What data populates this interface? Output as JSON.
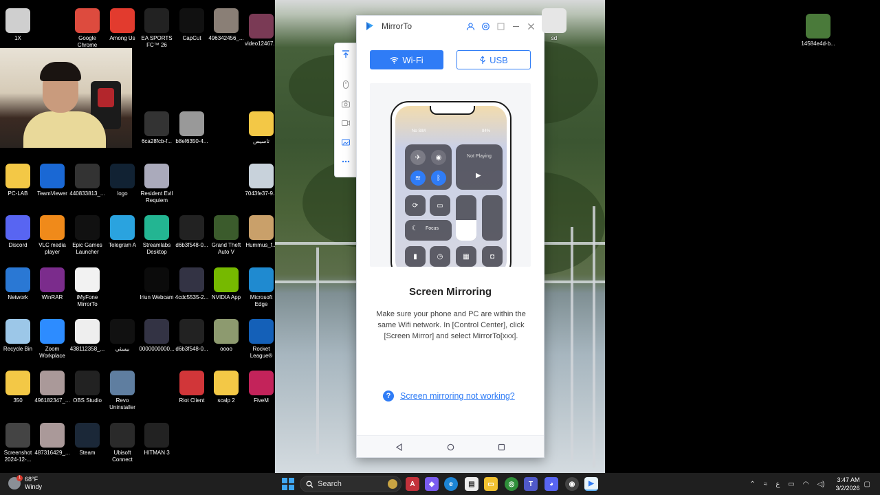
{
  "desktop_icons": [
    {
      "label": "1X"
    },
    {
      "label": "Google Chrome"
    },
    {
      "label": "Among Us"
    },
    {
      "label": "EA SPORTS FC™ 26"
    },
    {
      "label": "CapCut"
    },
    {
      "label": "496342456_..."
    },
    {
      "label": "video12467..."
    },
    {
      "label": "6ca28fcb-f..."
    },
    {
      "label": "b8ef6350-4..."
    },
    {
      "label": "تاسيس"
    },
    {
      "label": "PC-LAB"
    },
    {
      "label": "TeamViewer"
    },
    {
      "label": "440833813_..."
    },
    {
      "label": "logo"
    },
    {
      "label": "Resident Evil Requiem"
    },
    {
      "label": "7043fe37-9..."
    },
    {
      "label": "Discord"
    },
    {
      "label": "VLC media player"
    },
    {
      "label": "Epic Games Launcher"
    },
    {
      "label": "Telegram A"
    },
    {
      "label": "Streamlabs Desktop"
    },
    {
      "label": "d6b3f548-0..."
    },
    {
      "label": "Grand Theft Auto V"
    },
    {
      "label": "Hummus_f..."
    },
    {
      "label": "Network"
    },
    {
      "label": "WinRAR"
    },
    {
      "label": "iMyFone MirrorTo"
    },
    {
      "label": "Iriun Webcam"
    },
    {
      "label": "4cdc5535-2..."
    },
    {
      "label": "NVIDIA App"
    },
    {
      "label": "Microsoft Edge"
    },
    {
      "label": "Recycle Bin"
    },
    {
      "label": "Zoom Workplace"
    },
    {
      "label": "438112358_..."
    },
    {
      "label": "بيسثي"
    },
    {
      "label": "0000000000..."
    },
    {
      "label": "d6b3f548-0..."
    },
    {
      "label": "oooo"
    },
    {
      "label": "Rocket League®"
    },
    {
      "label": "350"
    },
    {
      "label": "496182347_..."
    },
    {
      "label": "OBS Studio"
    },
    {
      "label": "Revo Uninstaller"
    },
    {
      "label": "Riot Client"
    },
    {
      "label": "scalp 2"
    },
    {
      "label": "FiveM"
    },
    {
      "label": "Screenshot 2024-12-..."
    },
    {
      "label": "487316429_..."
    },
    {
      "label": "Steam"
    },
    {
      "label": "Ubisoft Connect"
    },
    {
      "label": "HITMAN 3"
    },
    {
      "label": "14584e4d-b..."
    },
    {
      "label": "sd"
    }
  ],
  "mirrorto": {
    "title": "MirrorTo",
    "tabs": {
      "wifi": "Wi-Fi",
      "usb": "USB"
    },
    "phone": {
      "status_left": "No SIM",
      "status_right": "84%",
      "now_playing": "Not Playing",
      "focus": "Focus"
    },
    "heading": "Screen Mirroring",
    "description": "Make sure your phone and PC are within the same Wifi network. In [Control Center], click [Screen Mirror] and select MirrorTo[xxx].",
    "help_link": "Screen mirroring not working?"
  },
  "taskbar": {
    "weather_temp": "68°F",
    "weather_desc": "Windy",
    "weather_badge": "1",
    "search_placeholder": "Search",
    "time": "3:47 AM",
    "date": "3/2/2026",
    "lang": "ع"
  },
  "colors": {
    "accent": "#2f7cf6",
    "taskbar": "#1f1f1f"
  }
}
